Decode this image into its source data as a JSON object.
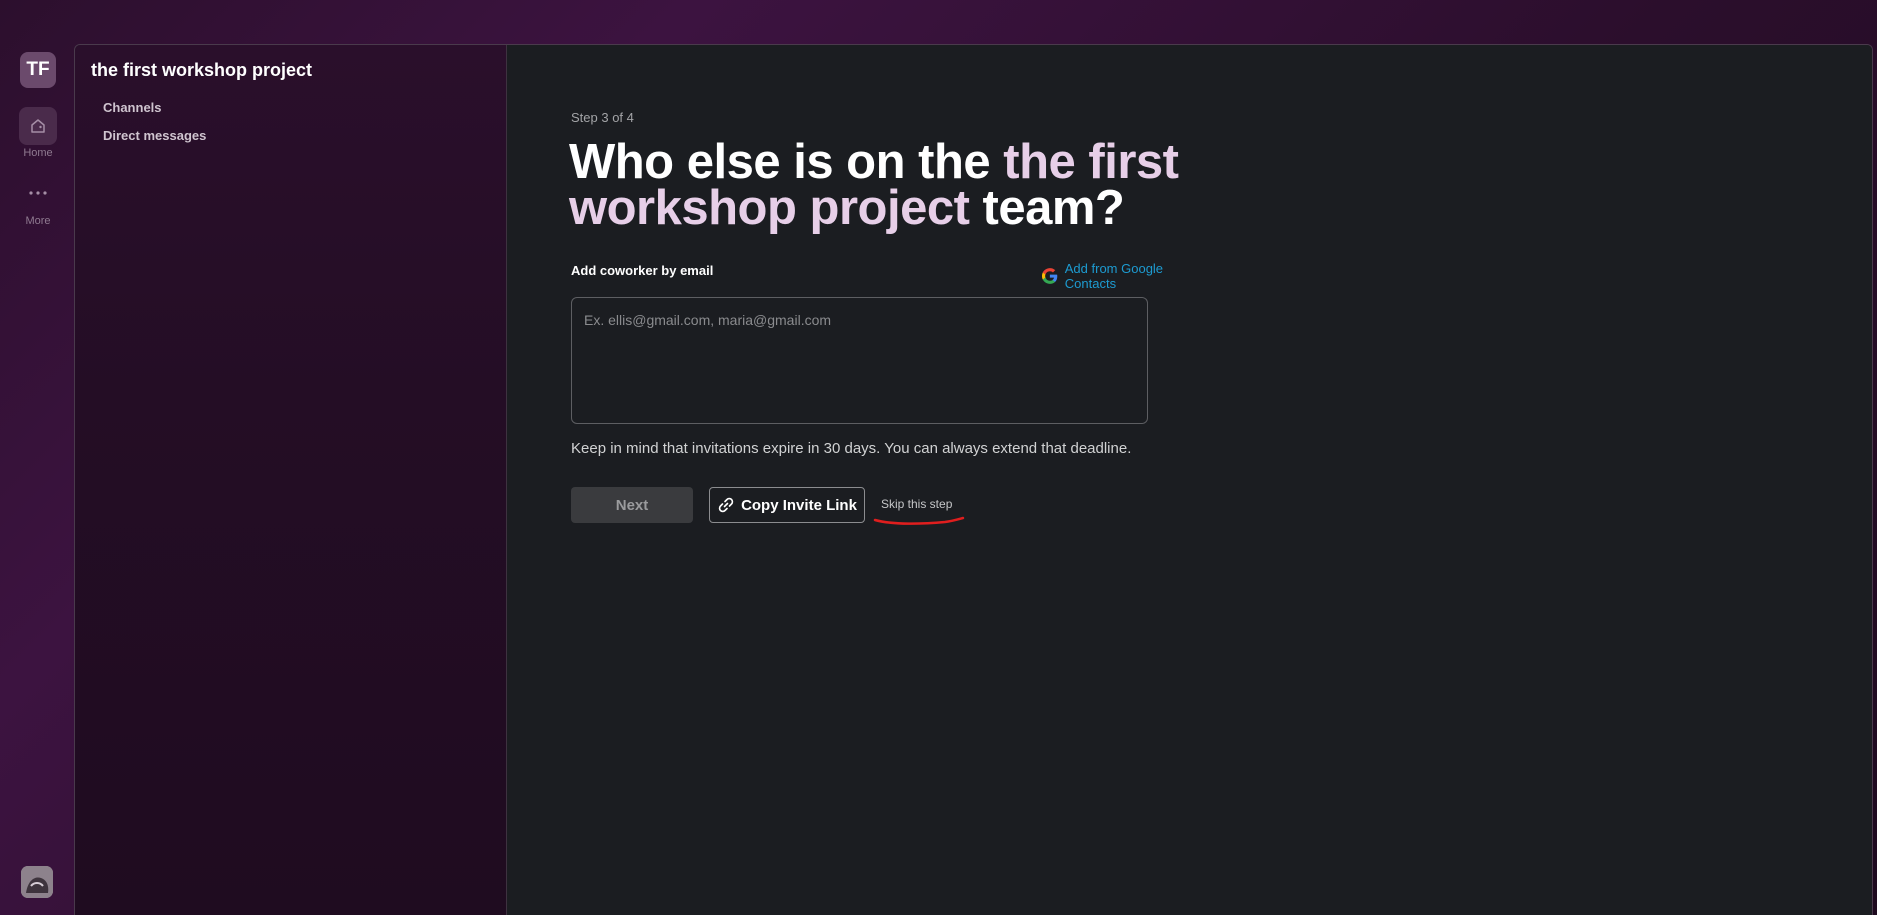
{
  "rail": {
    "workspace_initials": "TF",
    "home_label": "Home",
    "more_label": "More"
  },
  "sidebar": {
    "workspace_name": "the first workshop project",
    "items": [
      {
        "label": "Channels"
      },
      {
        "label": "Direct messages"
      }
    ]
  },
  "main": {
    "step": "Step 3 of 4",
    "heading": {
      "prefix": "Who else is on the ",
      "accent": "the first workshop project",
      "suffix": " team?"
    },
    "field_label": "Add coworker by email",
    "google_link": "Add from Google Contacts",
    "email_placeholder": "Ex. ellis@gmail.com, maria@gmail.com",
    "note": "Keep in mind that invitations expire in 30 days. You can always extend that deadline.",
    "next_label": "Next",
    "copy_label": "Copy Invite Link",
    "skip_label": "Skip this step"
  },
  "colors": {
    "accent_text": "#e7cfe8",
    "link": "#1d9bd1",
    "annotation": "#e01e1e"
  }
}
